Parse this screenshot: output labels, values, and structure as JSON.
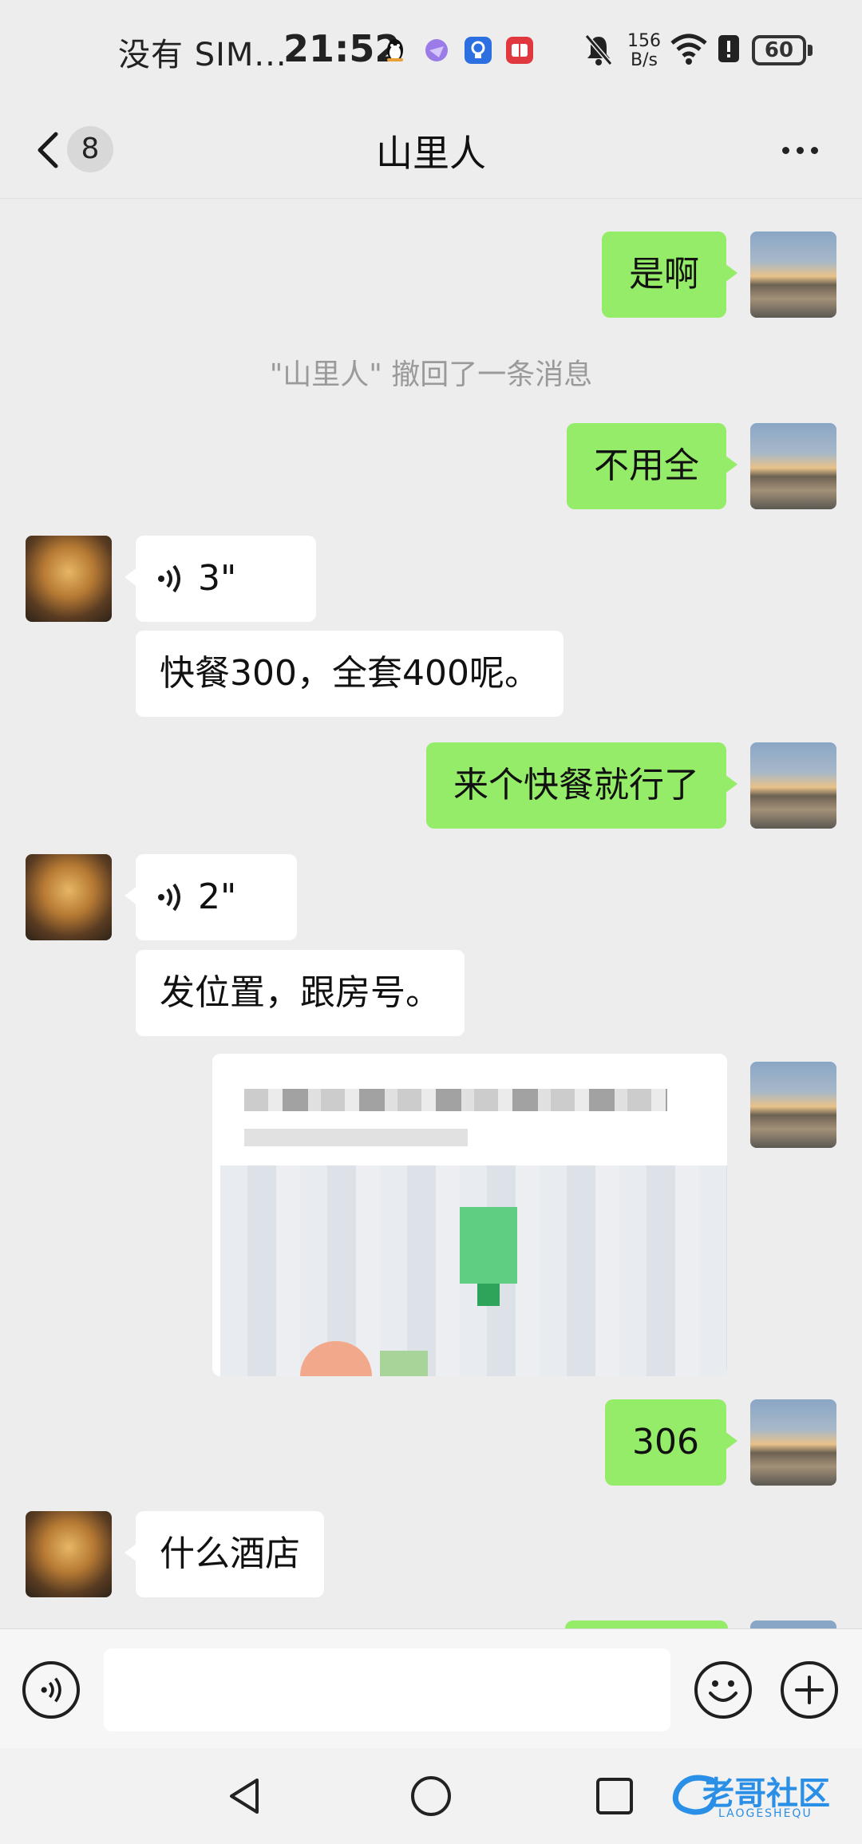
{
  "status_bar": {
    "carrier": "没有 SIM...",
    "time": "21:52",
    "net_speed_value": "156",
    "net_speed_unit": "B/s",
    "battery": "60"
  },
  "header": {
    "unread_count": "8",
    "title": "山里人"
  },
  "messages": {
    "m1": "是啊",
    "recall_notice": "\"山里人\" 撤回了一条消息",
    "m2": "不用全",
    "voice1": "3\"",
    "m3": "快餐300，全套400呢。",
    "m4": "来个快餐就行了",
    "voice2": "2\"",
    "m5": "发位置，跟房号。",
    "m6": "306",
    "m7": "什么酒店"
  },
  "watermark": {
    "text": "老哥社区",
    "sub": "LAOGESHEQU"
  },
  "colors": {
    "self_bubble": "#95ec69",
    "other_bubble": "#ffffff",
    "background": "#ededed"
  }
}
